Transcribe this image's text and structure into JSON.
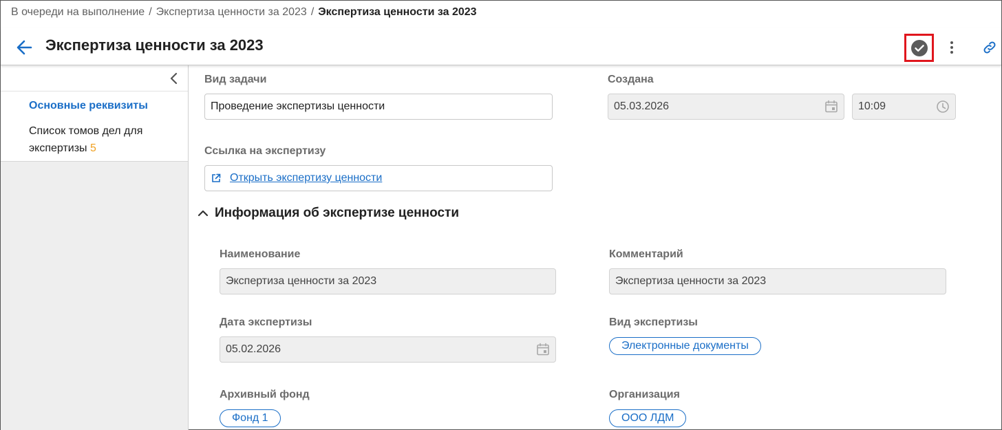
{
  "breadcrumb": {
    "items": [
      "В очереди на выполнение",
      "Экспертиза ценности за 2023"
    ],
    "current": "Экспертиза ценности за 2023",
    "separator": "/"
  },
  "header": {
    "title": "Экспертиза ценности за 2023",
    "icons": {
      "back": "arrow-left-icon",
      "complete": "check-circle-icon",
      "more": "more-vertical-icon",
      "link": "link-icon"
    }
  },
  "sidebar": {
    "items": [
      {
        "label": "Основные реквизиты",
        "active": true
      },
      {
        "label": "Список томов дел для экспертизы",
        "count": "5"
      }
    ]
  },
  "form": {
    "task_type": {
      "label": "Вид задачи",
      "value": "Проведение экспертизы ценности"
    },
    "created": {
      "label": "Создана",
      "date": "05.03.2026",
      "time": "10:09"
    },
    "expertise_link": {
      "label": "Ссылка на экспертизу",
      "link_text": "Открыть экспертизу ценности"
    }
  },
  "section": {
    "title": "Информация об экспертизе ценности",
    "name": {
      "label": "Наименование",
      "value": "Экспертиза ценности за 2023"
    },
    "comment": {
      "label": "Комментарий",
      "value": "Экспертиза ценности за 2023"
    },
    "date": {
      "label": "Дата экспертизы",
      "value": "05.02.2026"
    },
    "type": {
      "label": "Вид экспертизы",
      "value": "Электронные документы"
    },
    "fund": {
      "label": "Архивный фонд",
      "value": "Фонд 1"
    },
    "organization": {
      "label": "Организация",
      "value": "ООО ЛДМ"
    }
  },
  "colors": {
    "accent": "#1a6ec7",
    "highlight": "#e0161d",
    "count": "#f0a020"
  }
}
